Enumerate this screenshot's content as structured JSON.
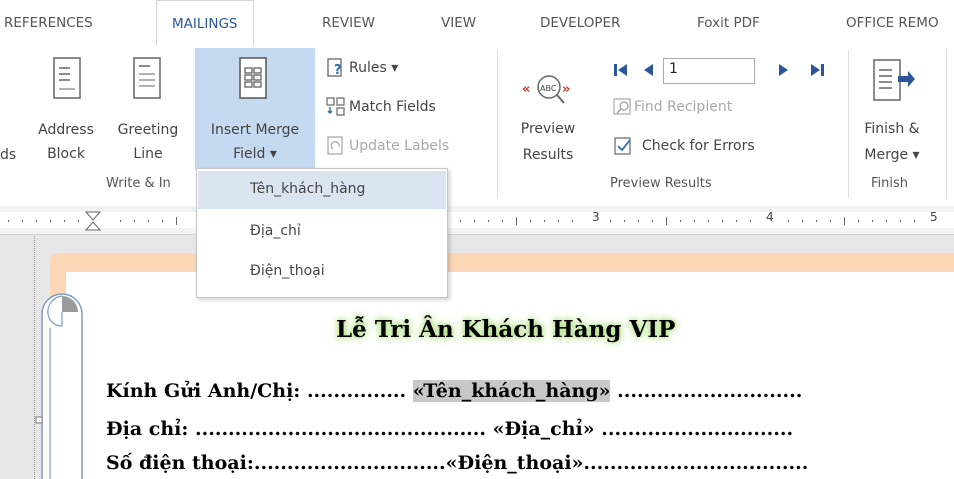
{
  "tabs": [
    "REFERENCES",
    "MAILINGS",
    "REVIEW",
    "VIEW",
    "DEVELOPER",
    "Foxit PDF",
    "OFFICE REMO"
  ],
  "ribbon": {
    "partial_left_label": "ds",
    "address_block": [
      "Address",
      "Block"
    ],
    "greeting_line": [
      "Greeting",
      "Line"
    ],
    "insert_merge_field": [
      "Insert Merge",
      "Field ▾"
    ],
    "rules": "Rules ▾",
    "match_fields": "Match Fields",
    "update_labels": "Update Labels",
    "preview_results": [
      "Preview",
      "Results"
    ],
    "record_number": "1",
    "find_recipient": "Find Recipient",
    "check_for_errors": "Check for Errors",
    "finish_merge": [
      "Finish &",
      "Merge ▾"
    ],
    "group_write_insert": "Write & In",
    "group_preview": "Preview Results",
    "group_finish": "Finish"
  },
  "ruler": {
    "n3": "3",
    "n4": "4",
    "n5": "5"
  },
  "dropdown": {
    "items": [
      "Tên_khách_hàng",
      "Địa_chỉ",
      "Điện_thoại"
    ]
  },
  "document": {
    "title": "Lễ Tri Ân Khách Hàng VIP",
    "line1_prefix": "Kính Gửi Anh/Chị: ...............",
    "line1_field": "«Tên_khách_hàng»",
    "line1_suffix": "............................",
    "line2": "Địa chỉ: ............................................ «Địa_chỉ» .............................",
    "line3": "Số điện thoại:.............................«Điện_thoại».................................."
  }
}
